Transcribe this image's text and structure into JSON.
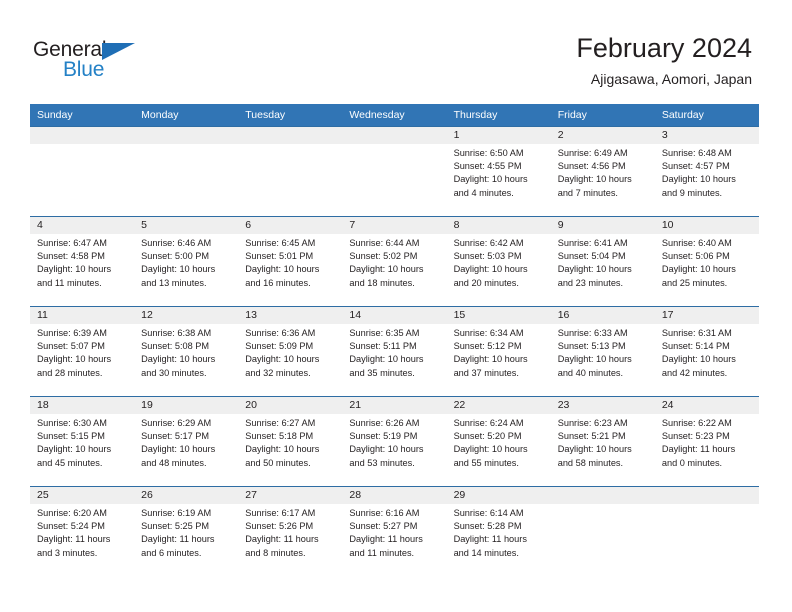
{
  "brand": {
    "name_part1": "General",
    "name_part2": "Blue"
  },
  "header": {
    "title": "February 2024",
    "subtitle": "Ajigasawa, Aomori, Japan"
  },
  "colors": {
    "header_blue": "#3175b5",
    "row_rule_blue": "#2e6da4",
    "daynum_band": "#efefef",
    "logo_blue": "#2481c6",
    "text": "#231f20"
  },
  "weekday_headers": [
    "Sunday",
    "Monday",
    "Tuesday",
    "Wednesday",
    "Thursday",
    "Friday",
    "Saturday"
  ],
  "labels": {
    "sunrise": "Sunrise:",
    "sunset": "Sunset:",
    "daylight": "Daylight:"
  },
  "weeks": [
    [
      {
        "day": "",
        "empty": true
      },
      {
        "day": "",
        "empty": true
      },
      {
        "day": "",
        "empty": true
      },
      {
        "day": "",
        "empty": true
      },
      {
        "day": "1",
        "sunrise": "Sunrise: 6:50 AM",
        "sunset": "Sunset: 4:55 PM",
        "daylight": "Daylight: 10 hours and 4 minutes."
      },
      {
        "day": "2",
        "sunrise": "Sunrise: 6:49 AM",
        "sunset": "Sunset: 4:56 PM",
        "daylight": "Daylight: 10 hours and 7 minutes."
      },
      {
        "day": "3",
        "sunrise": "Sunrise: 6:48 AM",
        "sunset": "Sunset: 4:57 PM",
        "daylight": "Daylight: 10 hours and 9 minutes."
      }
    ],
    [
      {
        "day": "4",
        "sunrise": "Sunrise: 6:47 AM",
        "sunset": "Sunset: 4:58 PM",
        "daylight": "Daylight: 10 hours and 11 minutes."
      },
      {
        "day": "5",
        "sunrise": "Sunrise: 6:46 AM",
        "sunset": "Sunset: 5:00 PM",
        "daylight": "Daylight: 10 hours and 13 minutes."
      },
      {
        "day": "6",
        "sunrise": "Sunrise: 6:45 AM",
        "sunset": "Sunset: 5:01 PM",
        "daylight": "Daylight: 10 hours and 16 minutes."
      },
      {
        "day": "7",
        "sunrise": "Sunrise: 6:44 AM",
        "sunset": "Sunset: 5:02 PM",
        "daylight": "Daylight: 10 hours and 18 minutes."
      },
      {
        "day": "8",
        "sunrise": "Sunrise: 6:42 AM",
        "sunset": "Sunset: 5:03 PM",
        "daylight": "Daylight: 10 hours and 20 minutes."
      },
      {
        "day": "9",
        "sunrise": "Sunrise: 6:41 AM",
        "sunset": "Sunset: 5:04 PM",
        "daylight": "Daylight: 10 hours and 23 minutes."
      },
      {
        "day": "10",
        "sunrise": "Sunrise: 6:40 AM",
        "sunset": "Sunset: 5:06 PM",
        "daylight": "Daylight: 10 hours and 25 minutes."
      }
    ],
    [
      {
        "day": "11",
        "sunrise": "Sunrise: 6:39 AM",
        "sunset": "Sunset: 5:07 PM",
        "daylight": "Daylight: 10 hours and 28 minutes."
      },
      {
        "day": "12",
        "sunrise": "Sunrise: 6:38 AM",
        "sunset": "Sunset: 5:08 PM",
        "daylight": "Daylight: 10 hours and 30 minutes."
      },
      {
        "day": "13",
        "sunrise": "Sunrise: 6:36 AM",
        "sunset": "Sunset: 5:09 PM",
        "daylight": "Daylight: 10 hours and 32 minutes."
      },
      {
        "day": "14",
        "sunrise": "Sunrise: 6:35 AM",
        "sunset": "Sunset: 5:11 PM",
        "daylight": "Daylight: 10 hours and 35 minutes."
      },
      {
        "day": "15",
        "sunrise": "Sunrise: 6:34 AM",
        "sunset": "Sunset: 5:12 PM",
        "daylight": "Daylight: 10 hours and 37 minutes."
      },
      {
        "day": "16",
        "sunrise": "Sunrise: 6:33 AM",
        "sunset": "Sunset: 5:13 PM",
        "daylight": "Daylight: 10 hours and 40 minutes."
      },
      {
        "day": "17",
        "sunrise": "Sunrise: 6:31 AM",
        "sunset": "Sunset: 5:14 PM",
        "daylight": "Daylight: 10 hours and 42 minutes."
      }
    ],
    [
      {
        "day": "18",
        "sunrise": "Sunrise: 6:30 AM",
        "sunset": "Sunset: 5:15 PM",
        "daylight": "Daylight: 10 hours and 45 minutes."
      },
      {
        "day": "19",
        "sunrise": "Sunrise: 6:29 AM",
        "sunset": "Sunset: 5:17 PM",
        "daylight": "Daylight: 10 hours and 48 minutes."
      },
      {
        "day": "20",
        "sunrise": "Sunrise: 6:27 AM",
        "sunset": "Sunset: 5:18 PM",
        "daylight": "Daylight: 10 hours and 50 minutes."
      },
      {
        "day": "21",
        "sunrise": "Sunrise: 6:26 AM",
        "sunset": "Sunset: 5:19 PM",
        "daylight": "Daylight: 10 hours and 53 minutes."
      },
      {
        "day": "22",
        "sunrise": "Sunrise: 6:24 AM",
        "sunset": "Sunset: 5:20 PM",
        "daylight": "Daylight: 10 hours and 55 minutes."
      },
      {
        "day": "23",
        "sunrise": "Sunrise: 6:23 AM",
        "sunset": "Sunset: 5:21 PM",
        "daylight": "Daylight: 10 hours and 58 minutes."
      },
      {
        "day": "24",
        "sunrise": "Sunrise: 6:22 AM",
        "sunset": "Sunset: 5:23 PM",
        "daylight": "Daylight: 11 hours and 0 minutes."
      }
    ],
    [
      {
        "day": "25",
        "sunrise": "Sunrise: 6:20 AM",
        "sunset": "Sunset: 5:24 PM",
        "daylight": "Daylight: 11 hours and 3 minutes."
      },
      {
        "day": "26",
        "sunrise": "Sunrise: 6:19 AM",
        "sunset": "Sunset: 5:25 PM",
        "daylight": "Daylight: 11 hours and 6 minutes."
      },
      {
        "day": "27",
        "sunrise": "Sunrise: 6:17 AM",
        "sunset": "Sunset: 5:26 PM",
        "daylight": "Daylight: 11 hours and 8 minutes."
      },
      {
        "day": "28",
        "sunrise": "Sunrise: 6:16 AM",
        "sunset": "Sunset: 5:27 PM",
        "daylight": "Daylight: 11 hours and 11 minutes."
      },
      {
        "day": "29",
        "sunrise": "Sunrise: 6:14 AM",
        "sunset": "Sunset: 5:28 PM",
        "daylight": "Daylight: 11 hours and 14 minutes."
      },
      {
        "day": "",
        "empty": true
      },
      {
        "day": "",
        "empty": true
      }
    ]
  ]
}
